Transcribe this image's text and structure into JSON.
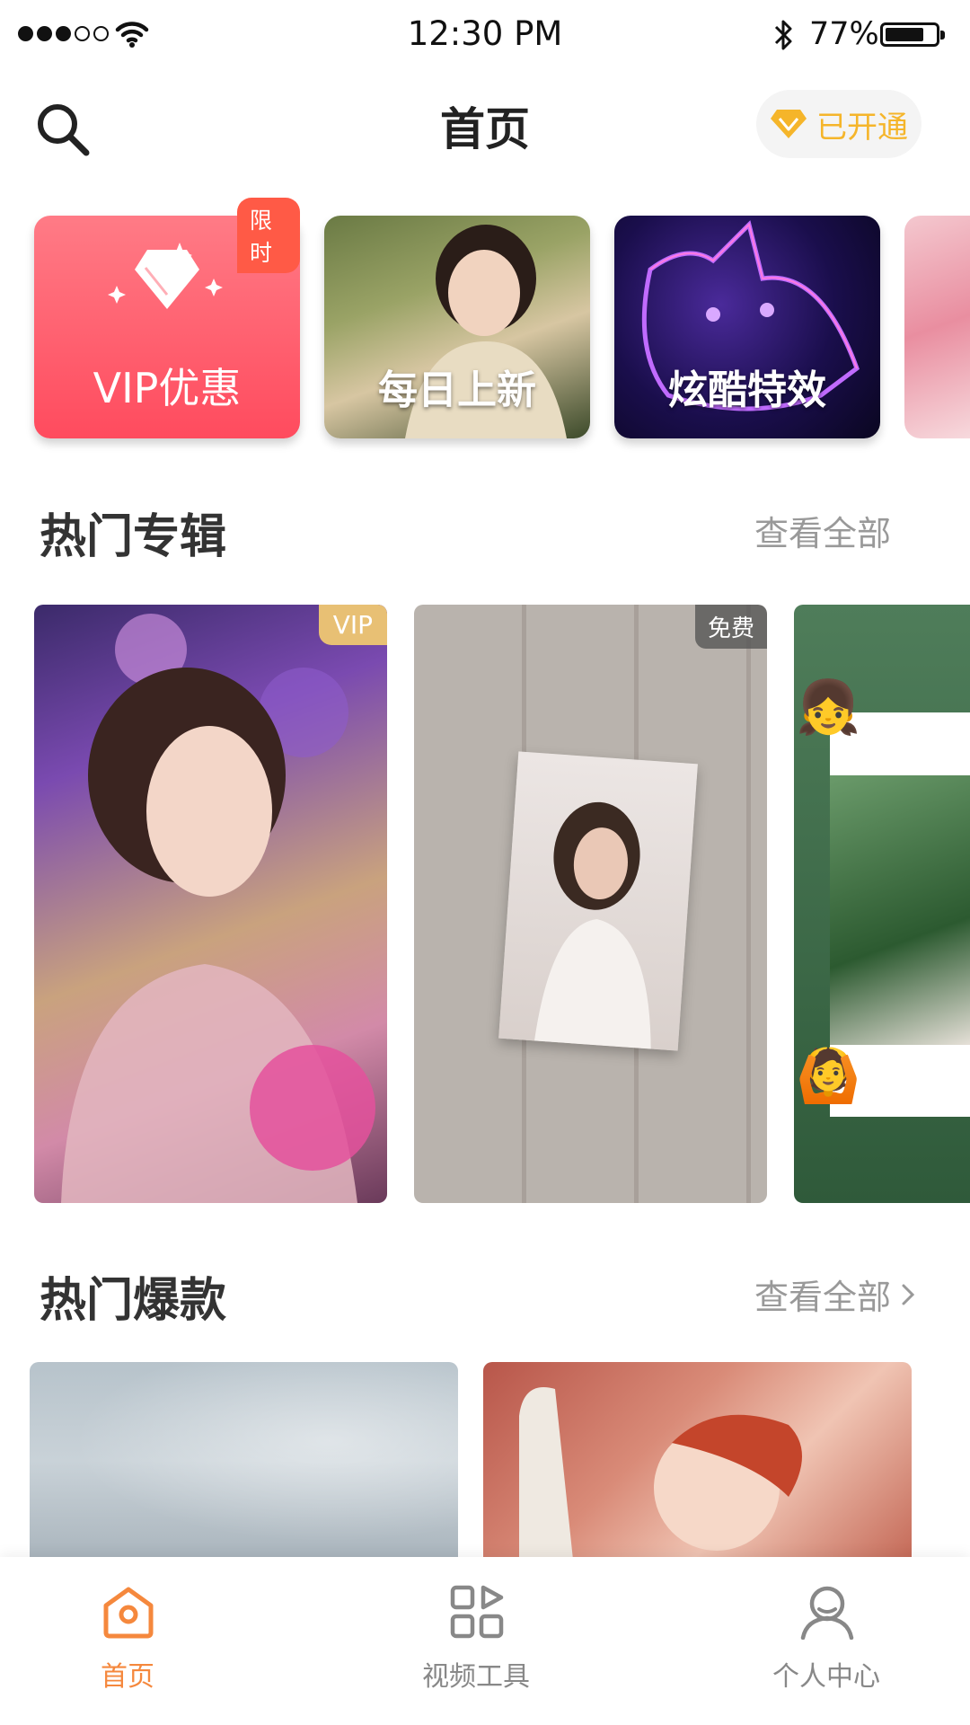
{
  "status_bar": {
    "time": "12:30 PM",
    "battery_percent": "77%",
    "battery_level": 0.77,
    "signal_bars_filled": 3,
    "signal_bars_total": 5
  },
  "header": {
    "title": "首页",
    "vip_status": "已开通",
    "accent_color": "#f5b52a"
  },
  "categories": [
    {
      "label": "VIP优惠",
      "badge": "限时"
    },
    {
      "label": "每日上新"
    },
    {
      "label": "炫酷特效"
    }
  ],
  "albums_section": {
    "title": "热门专辑",
    "see_all": "查看全部",
    "items": [
      {
        "tag": "VIP"
      },
      {
        "tag": "免费"
      },
      {
        "tag": ""
      }
    ]
  },
  "hot_section": {
    "title": "热门爆款",
    "see_all": "查看全部"
  },
  "tabbar": {
    "active_color": "#f5883d",
    "items": [
      {
        "label": "首页",
        "icon": "home-icon",
        "active": true
      },
      {
        "label": "视频工具",
        "icon": "tools-grid-icon",
        "active": false
      },
      {
        "label": "个人中心",
        "icon": "profile-icon",
        "active": false
      }
    ]
  }
}
